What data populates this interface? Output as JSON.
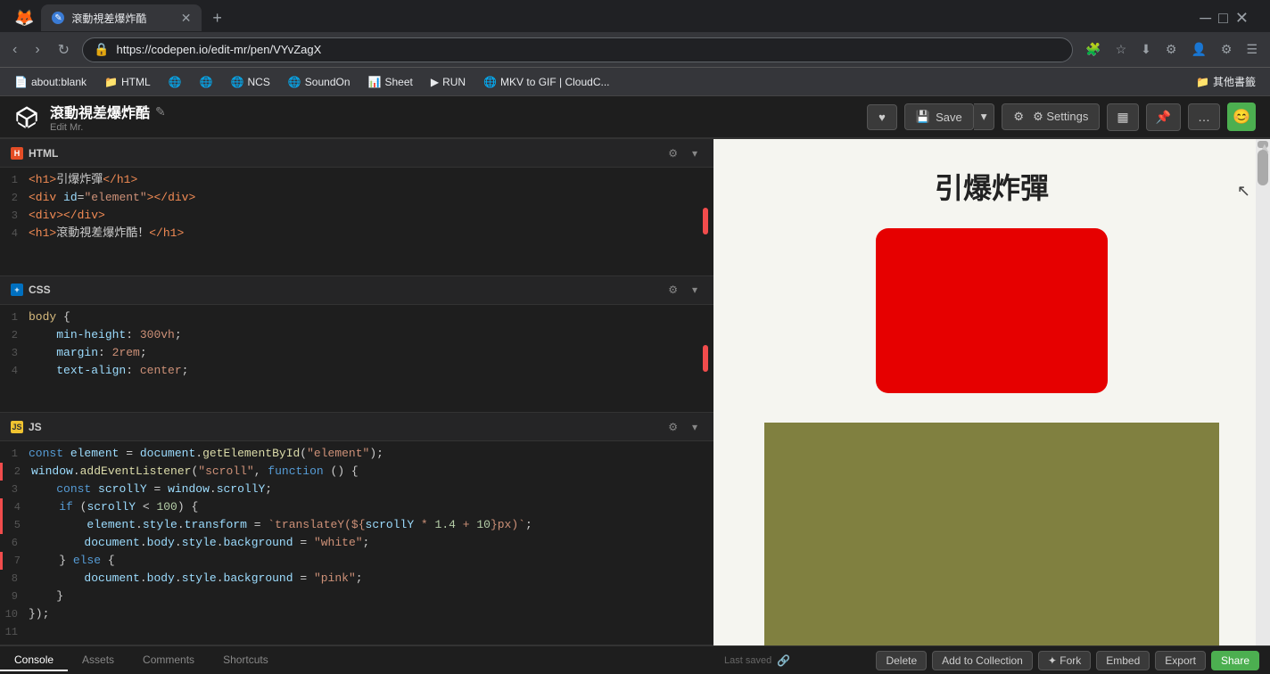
{
  "browser": {
    "tab_title": "滾動視差爆炸酷",
    "url": "https://codepen.io/edit-mr/pen/VYvZagX",
    "new_tab_label": "+",
    "bookmarks": [
      {
        "label": "about:blank",
        "icon": "📄"
      },
      {
        "label": "HTML",
        "icon": "📁"
      },
      {
        "label": "",
        "icon": "🌐"
      },
      {
        "label": "",
        "icon": "🌐"
      },
      {
        "label": "NCS",
        "icon": "🌐"
      },
      {
        "label": "SoundOn",
        "icon": "🌐"
      },
      {
        "label": "Sheet",
        "icon": "📊"
      },
      {
        "label": "RUN",
        "icon": "▶"
      },
      {
        "label": "MKV to GIF | CloudC...",
        "icon": "🌐"
      },
      {
        "label": "其他書籤",
        "icon": "📁"
      }
    ]
  },
  "codepen": {
    "title": "滾動視差爆炸酷",
    "subtitle": "Edit Mr.",
    "heart_label": "♥",
    "save_label": "Save",
    "settings_label": "⚙ Settings",
    "view_label": "▦",
    "pin_label": "📌",
    "more_label": "…",
    "avatar_icon": "😊"
  },
  "html_section": {
    "label": "HTML",
    "lines": [
      {
        "num": 1,
        "content": "<h1>引爆炸彈</h1>"
      },
      {
        "num": 2,
        "content": "<div id=\"element\"></div>"
      },
      {
        "num": 3,
        "content": "<div></div>"
      },
      {
        "num": 4,
        "content": "<h1>滾動視差爆炸酷！</h1>"
      }
    ]
  },
  "css_section": {
    "label": "CSS",
    "lines": [
      {
        "num": 1,
        "content": "body {"
      },
      {
        "num": 2,
        "content": "    min-height: 300vh;"
      },
      {
        "num": 3,
        "content": "    margin: 2rem;"
      },
      {
        "num": 4,
        "content": "    text-align: center;"
      }
    ]
  },
  "js_section": {
    "label": "JS",
    "lines": [
      {
        "num": 1,
        "content": "const element = document.getElementById(\"element\");"
      },
      {
        "num": 2,
        "content": "window.addEventListener(\"scroll\", function () {"
      },
      {
        "num": 3,
        "content": "    const scrollY = window.scrollY;"
      },
      {
        "num": 4,
        "content": "    if (scrollY < 100) {"
      },
      {
        "num": 5,
        "content": "        element.style.transform = `translateY(${scrollY * 1.4 + 10}px)`;"
      },
      {
        "num": 6,
        "content": "        document.body.style.background = \"white\";"
      },
      {
        "num": 7,
        "content": "    } else {"
      },
      {
        "num": 8,
        "content": "        document.body.style.background = \"pink\";"
      },
      {
        "num": 9,
        "content": "    }"
      },
      {
        "num": 10,
        "content": "});"
      },
      {
        "num": 11,
        "content": ""
      }
    ]
  },
  "preview": {
    "title": "引爆炸彈"
  },
  "bottom_tabs": {
    "console": "Console",
    "assets": "Assets",
    "comments": "Comments",
    "shortcuts": "Shortcuts"
  },
  "bottom_actions": {
    "last_saved": "Last saved",
    "delete": "Delete",
    "add_to_collection": "Add to Collection",
    "fork": "✦ Fork",
    "embed": "Embed",
    "export": "Export",
    "share": "Share"
  }
}
